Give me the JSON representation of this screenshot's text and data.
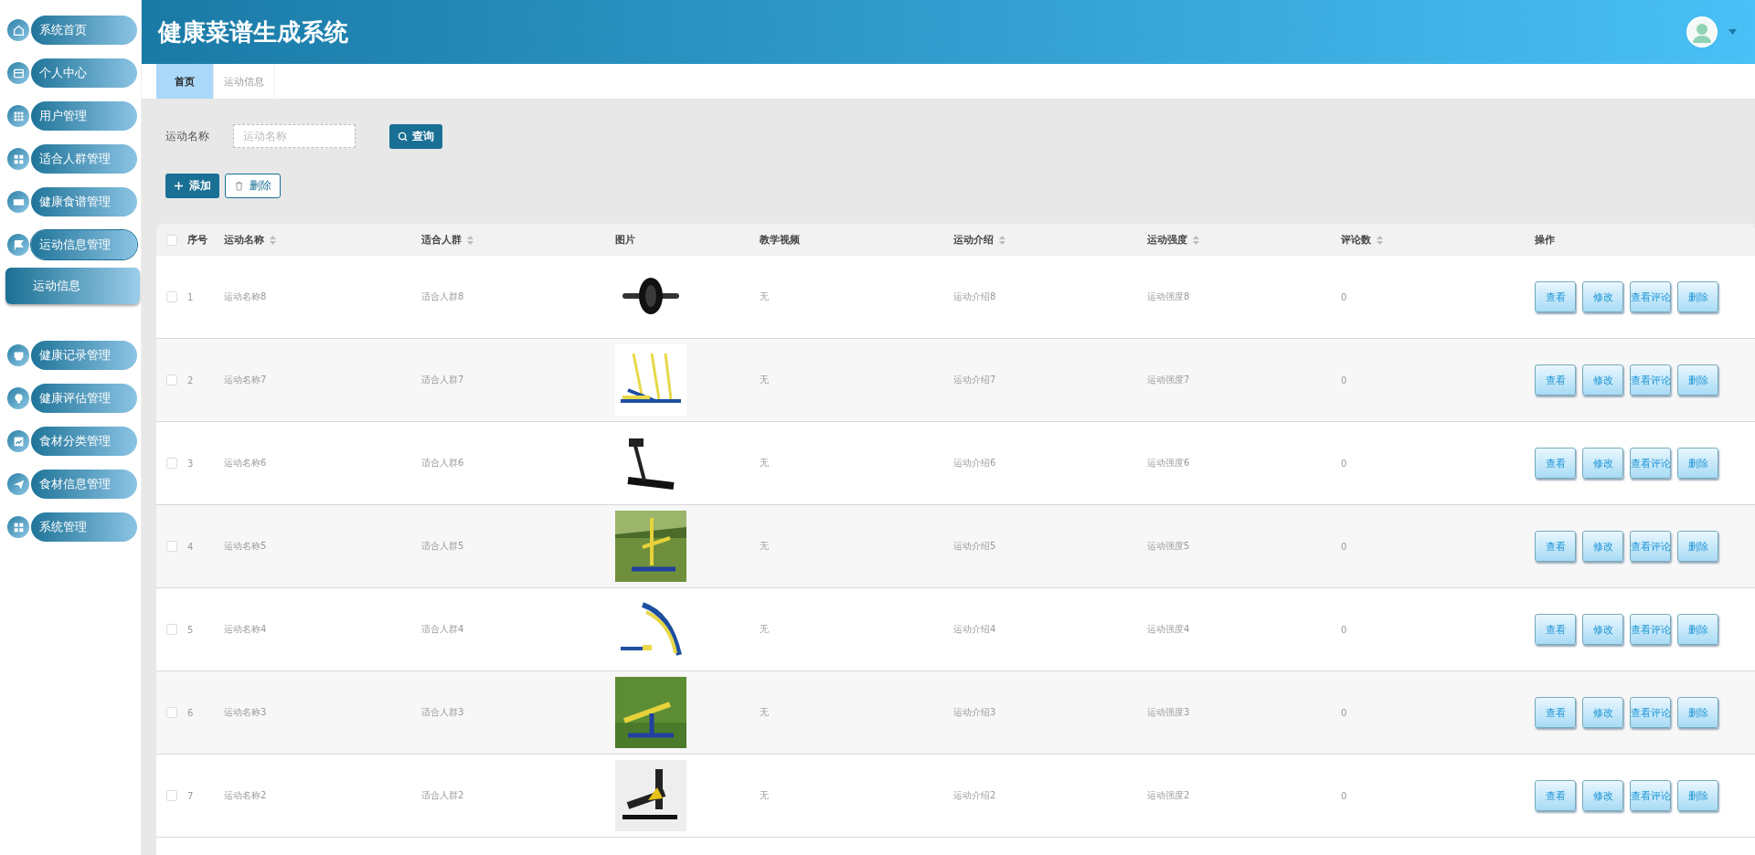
{
  "sidebar": {
    "items": [
      {
        "label": "系统首页",
        "expanded": false
      },
      {
        "label": "个人中心",
        "expanded": false
      },
      {
        "label": "用户管理",
        "expanded": false
      },
      {
        "label": "适合人群管理",
        "expanded": false
      },
      {
        "label": "健康食谱管理",
        "expanded": false
      },
      {
        "label": "运动信息管理",
        "expanded": true,
        "children": [
          {
            "label": "运动信息"
          }
        ]
      },
      {
        "label": "健康记录管理",
        "expanded": false
      },
      {
        "label": "健康评估管理",
        "expanded": false
      },
      {
        "label": "食材分类管理",
        "expanded": false
      },
      {
        "label": "食材信息管理",
        "expanded": false
      },
      {
        "label": "系统管理",
        "expanded": false
      }
    ]
  },
  "header": {
    "title": "健康菜谱生成系统"
  },
  "tabs": [
    {
      "label": "首页",
      "selected": true
    },
    {
      "label": "运动信息",
      "selected": false
    }
  ],
  "search": {
    "label": "运动名称",
    "placeholder": "运动名称",
    "button": "查询"
  },
  "toolbar": {
    "add": "添加",
    "delete": "删除"
  },
  "table": {
    "all_checked": false,
    "columns": [
      {
        "label": "序号"
      },
      {
        "label": "运动名称",
        "sortable": true
      },
      {
        "label": "适合人群",
        "sortable": true
      },
      {
        "label": "图片"
      },
      {
        "label": "教学视频"
      },
      {
        "label": "运动介绍",
        "sortable": true
      },
      {
        "label": "运动强度",
        "sortable": true
      },
      {
        "label": "评论数",
        "sortable": true
      },
      {
        "label": "操作"
      }
    ],
    "rows": [
      {
        "checked": false,
        "cells": [
          "1",
          "运动名称8",
          "适合人群8",
          {
            "kind": "picture"
          },
          "无",
          "运动介绍8",
          "运动强度8",
          "0"
        ],
        "actions": [
          "查看",
          "修改",
          "查看评论",
          "删除"
        ]
      },
      {
        "checked": false,
        "cells": [
          "2",
          "运动名称7",
          "适合人群7",
          {
            "kind": "picture"
          },
          "无",
          "运动介绍7",
          "运动强度7",
          "0"
        ],
        "actions": [
          "查看",
          "修改",
          "查看评论",
          "删除"
        ]
      },
      {
        "checked": false,
        "cells": [
          "3",
          "运动名称6",
          "适合人群6",
          {
            "kind": "picture"
          },
          "无",
          "运动介绍6",
          "运动强度6",
          "0"
        ],
        "actions": [
          "查看",
          "修改",
          "查看评论",
          "删除"
        ]
      },
      {
        "checked": false,
        "cells": [
          "4",
          "运动名称5",
          "适合人群5",
          {
            "kind": "picture"
          },
          "无",
          "运动介绍5",
          "运动强度5",
          "0"
        ],
        "actions": [
          "查看",
          "修改",
          "查看评论",
          "删除"
        ]
      },
      {
        "checked": false,
        "cells": [
          "5",
          "运动名称4",
          "适合人群4",
          {
            "kind": "picture"
          },
          "无",
          "运动介绍4",
          "运动强度4",
          "0"
        ],
        "actions": [
          "查看",
          "修改",
          "查看评论",
          "删除"
        ]
      },
      {
        "checked": false,
        "cells": [
          "6",
          "运动名称3",
          "适合人群3",
          {
            "kind": "picture"
          },
          "无",
          "运动介绍3",
          "运动强度3",
          "0"
        ],
        "actions": [
          "查看",
          "修改",
          "查看评论",
          "删除"
        ]
      },
      {
        "checked": false,
        "cells": [
          "7",
          "运动名称2",
          "适合人群2",
          {
            "kind": "picture"
          },
          "无",
          "运动介绍2",
          "运动强度2",
          "0"
        ],
        "actions": [
          "查看",
          "修改",
          "查看评论",
          "删除"
        ]
      }
    ]
  }
}
